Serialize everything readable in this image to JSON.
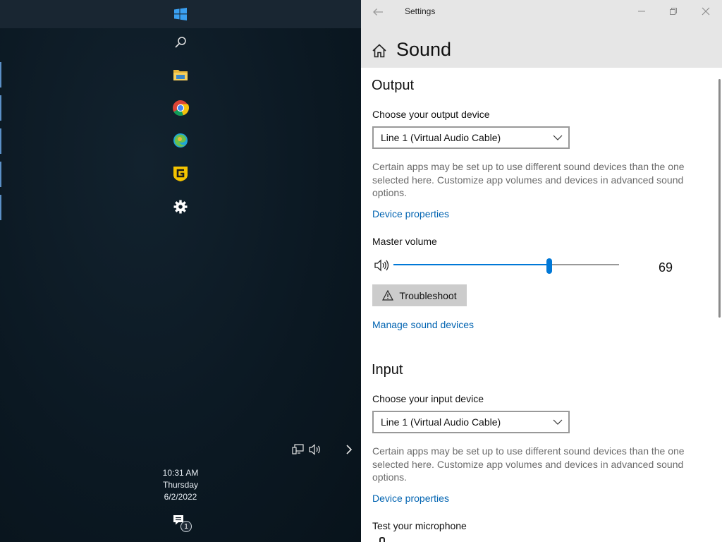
{
  "taskbar": {
    "icons": [
      "windows-start-icon",
      "search-icon",
      "file-explorer-icon",
      "chrome-icon",
      "edge-icon",
      "guardian-g-icon",
      "settings-gear-icon"
    ],
    "clock": {
      "time": "10:31 AM",
      "day": "Thursday",
      "date": "6/2/2022"
    },
    "notification_count": "1",
    "tray_icons": [
      "network-icon",
      "volume-icon",
      "chevron-right-icon"
    ]
  },
  "window": {
    "title": "Settings",
    "page_title": "Sound"
  },
  "output": {
    "heading": "Output",
    "device_label": "Choose your output device",
    "device_value": "Line 1 (Virtual Audio Cable)",
    "description": "Certain apps may be set up to use different sound devices than the one selected here. Customize app volumes and devices in advanced sound options.",
    "device_properties_link": "Device properties",
    "volume_label": "Master volume",
    "volume_value": "69",
    "volume_fraction": 0.69,
    "troubleshoot_label": "Troubleshoot",
    "manage_link": "Manage sound devices"
  },
  "input": {
    "heading": "Input",
    "device_label": "Choose your input device",
    "device_value": "Line 1 (Virtual Audio Cable)",
    "description": "Certain apps may be set up to use different sound devices than the one selected here. Customize app volumes and devices in advanced sound options.",
    "device_properties_link": "Device properties",
    "test_label": "Test your microphone"
  },
  "colors": {
    "accent": "#0078d7",
    "link": "#0063b1"
  }
}
